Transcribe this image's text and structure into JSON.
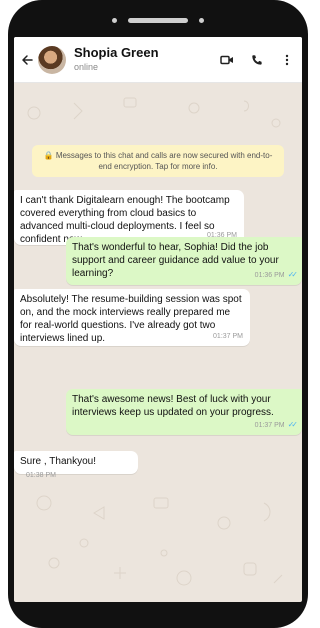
{
  "header": {
    "back_icon": "arrow-left-icon",
    "contact_name": "Shopia Green",
    "contact_status": "online",
    "icons": [
      "video-call-icon",
      "phone-call-icon",
      "more-vert-icon"
    ]
  },
  "notice": {
    "icon": "lock-icon",
    "text": "Messages to this chat and calls are now secured with end-to-end encryption. Tap for more info."
  },
  "messages": [
    {
      "direction": "incoming",
      "text": "I can't thank Digitalearn enough! The bootcamp covered everything from cloud basics to advanced multi-cloud deployments. I feel so confident now.",
      "time": "01:36 PM"
    },
    {
      "direction": "outgoing",
      "text": "That's wonderful to hear, Sophia! Did the job support and career guidance add value to your learning?",
      "time": "01:36 PM",
      "ticks": "✓✓"
    },
    {
      "direction": "incoming",
      "text": "Absolutely! The resume-building session was spot on, and the mock interviews really prepared me for real-world questions. I've already got two interviews lined up.",
      "time": "01:37 PM"
    },
    {
      "direction": "outgoing",
      "text": "That's awesome news! Best of luck with your interviews keep us updated on your progress.",
      "time": "01:37 PM",
      "ticks": "✓✓"
    },
    {
      "direction": "incoming",
      "text": "Sure , Thankyou!",
      "time": "01:38 PM"
    }
  ],
  "colors": {
    "chat_background": "#ece5dd",
    "incoming_bubble": "#ffffff",
    "outgoing_bubble": "#dcf8c6",
    "notice_background": "#fdf4c5",
    "read_ticks": "#4fb3f2"
  }
}
